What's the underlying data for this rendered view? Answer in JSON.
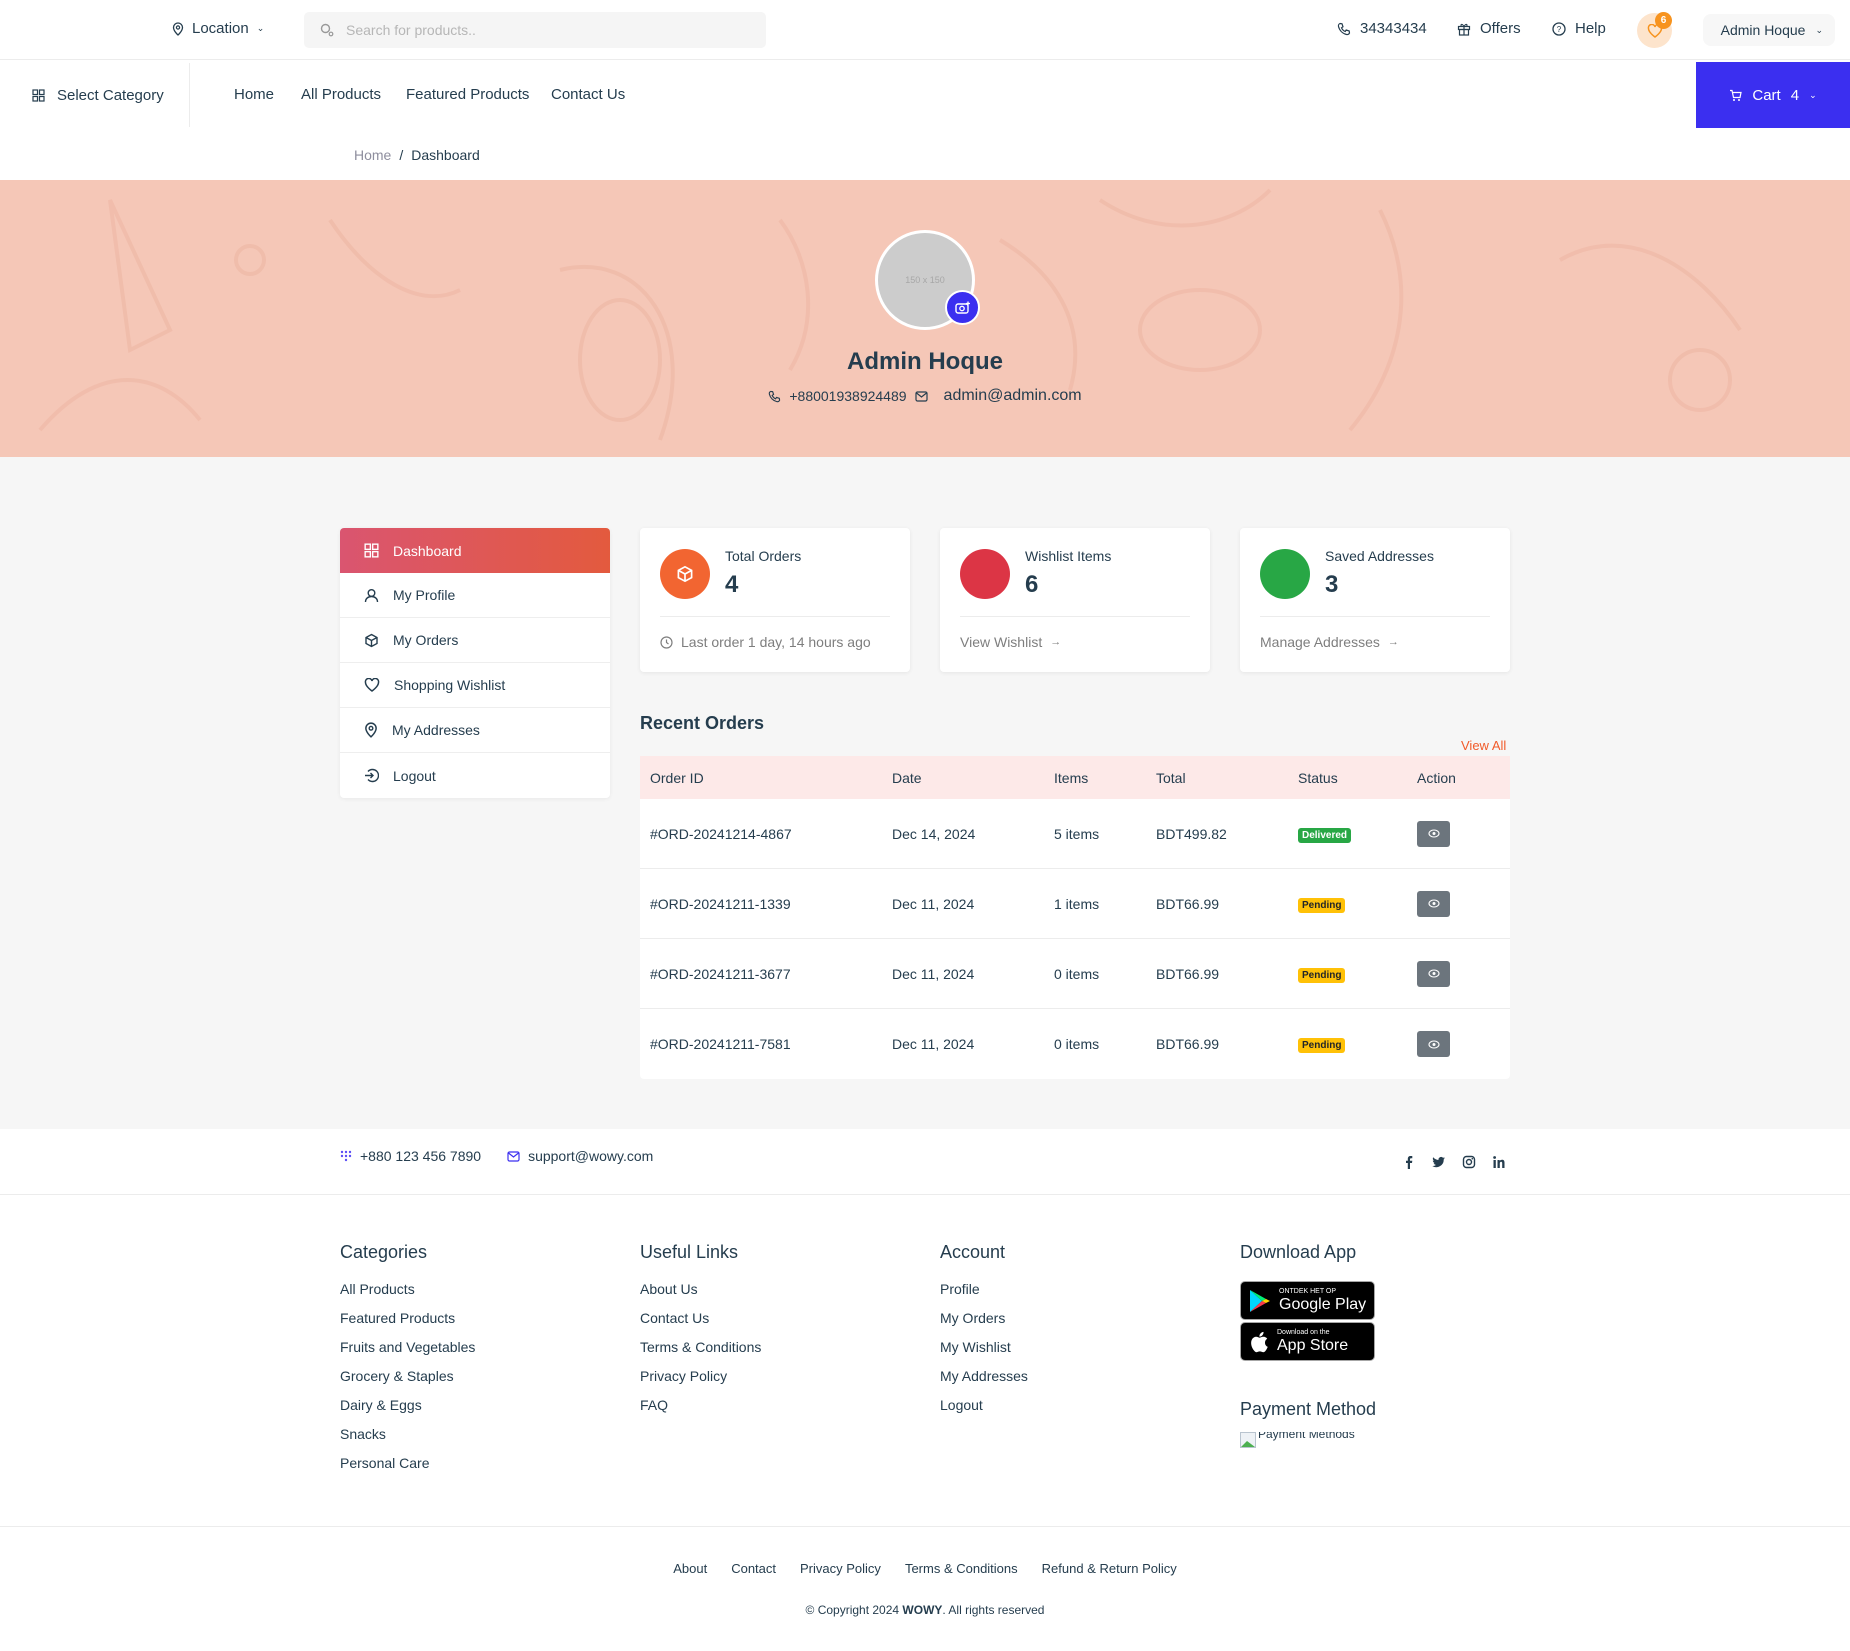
{
  "topbar": {
    "location_label": "Location",
    "search_placeholder": "Search for products..",
    "phone": "34343434",
    "offers": "Offers",
    "help": "Help",
    "wishlist_count": "6",
    "user_name": "Admin Hoque"
  },
  "nav": {
    "select_category": "Select Category",
    "links": [
      "Home",
      "All Products",
      "Featured Products",
      "Contact Us"
    ],
    "cart_label": "Cart",
    "cart_count": "4"
  },
  "breadcrumb": {
    "home": "Home",
    "separator": "/",
    "current": "Dashboard"
  },
  "profile": {
    "avatar_placeholder": "150 x 150",
    "name": "Admin Hoque",
    "phone": "+88001938924489",
    "email": "admin@admin.com"
  },
  "sidebar": {
    "items": [
      {
        "label": "Dashboard",
        "icon": "grid-icon",
        "active": true
      },
      {
        "label": "My Profile",
        "icon": "user-icon"
      },
      {
        "label": "My Orders",
        "icon": "box-icon"
      },
      {
        "label": "Shopping Wishlist",
        "icon": "heart-icon"
      },
      {
        "label": "My Addresses",
        "icon": "location-pin-icon"
      },
      {
        "label": "Logout",
        "icon": "logout-icon"
      }
    ]
  },
  "stats": [
    {
      "label": "Total Orders",
      "value": "4",
      "footer": "Last order 1 day, 14 hours ago",
      "color": "#f26531"
    },
    {
      "label": "Wishlist Items",
      "value": "6",
      "footer": "View Wishlist",
      "color": "#dc3545"
    },
    {
      "label": "Saved Addresses",
      "value": "3",
      "footer": "Manage Addresses",
      "color": "#28a745"
    }
  ],
  "recent_orders": {
    "title": "Recent Orders",
    "view_all": "View All",
    "columns": [
      "Order ID",
      "Date",
      "Items",
      "Total",
      "Status",
      "Action"
    ],
    "rows": [
      {
        "id": "#ORD-20241214-4867",
        "date": "Dec 14, 2024",
        "items": "5 items",
        "total": "BDT499.82",
        "status": "Delivered"
      },
      {
        "id": "#ORD-20241211-1339",
        "date": "Dec 11, 2024",
        "items": "1 items",
        "total": "BDT66.99",
        "status": "Pending"
      },
      {
        "id": "#ORD-20241211-3677",
        "date": "Dec 11, 2024",
        "items": "0 items",
        "total": "BDT66.99",
        "status": "Pending"
      },
      {
        "id": "#ORD-20241211-7581",
        "date": "Dec 11, 2024",
        "items": "0 items",
        "total": "BDT66.99",
        "status": "Pending"
      }
    ]
  },
  "footer": {
    "phone": "+880 123 456 7890",
    "email": "support@wowy.com",
    "categories": {
      "title": "Categories",
      "links": [
        "All Products",
        "Featured Products",
        "Fruits and Vegetables",
        "Grocery & Staples",
        "Dairy & Eggs",
        "Snacks",
        "Personal Care"
      ]
    },
    "useful": {
      "title": "Useful Links",
      "links": [
        "About Us",
        "Contact Us",
        "Terms & Conditions",
        "Privacy Policy",
        "FAQ"
      ]
    },
    "account": {
      "title": "Account",
      "links": [
        "Profile",
        "My Orders",
        "My Wishlist",
        "My Addresses",
        "Logout"
      ]
    },
    "download": {
      "title": "Download App",
      "google_small": "ONTDEK HET OP",
      "google_big": "Google Play",
      "apple_small": "Download on the",
      "apple_big": "App Store"
    },
    "payment": {
      "title": "Payment Method",
      "alt": "Payment Methods"
    },
    "bottom_links": [
      "About",
      "Contact",
      "Privacy Policy",
      "Terms & Conditions",
      "Refund & Return Policy"
    ],
    "copyright_pre": "© Copyright 2024 ",
    "brand": "WOWY",
    "copyright_post": ". All rights reserved"
  }
}
